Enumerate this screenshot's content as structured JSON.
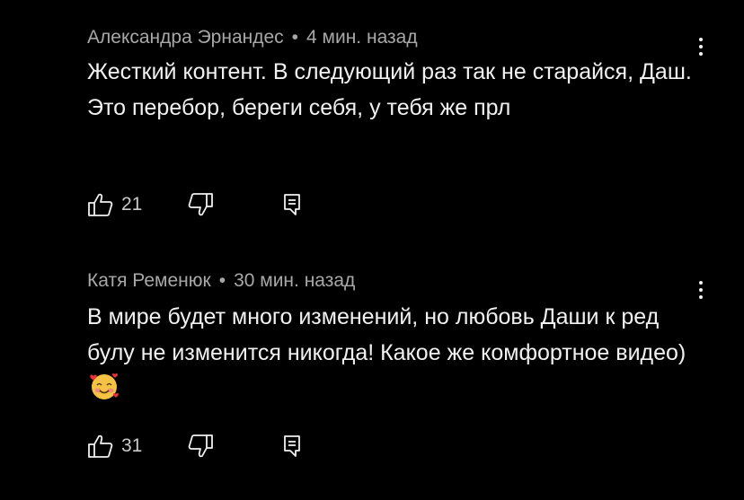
{
  "comments": [
    {
      "author": "Александра Эрнандес",
      "separator": "•",
      "time": "4 мин. назад",
      "text": "Жесткий контент. В следующий раз так не старайся, Даш. Это перебор, береги себя, у тебя же прл",
      "likes": "21",
      "emoji": ""
    },
    {
      "author": "Катя Ременюк",
      "separator": "•",
      "time": "30 мин. назад",
      "text": "В мире будет много изменений, но любовь Даши к ред булу не изменится никогда! Какое же комфортное видео)",
      "likes": "31",
      "emoji": "smiling-face-with-hearts"
    }
  ],
  "icons": {
    "like": "thumbs-up-icon",
    "dislike": "thumbs-down-icon",
    "reply": "reply-icon",
    "more": "more-vertical-icon"
  },
  "colors": {
    "background": "#000000",
    "text": "#f1f1f1",
    "meta": "#a8a8a8"
  }
}
